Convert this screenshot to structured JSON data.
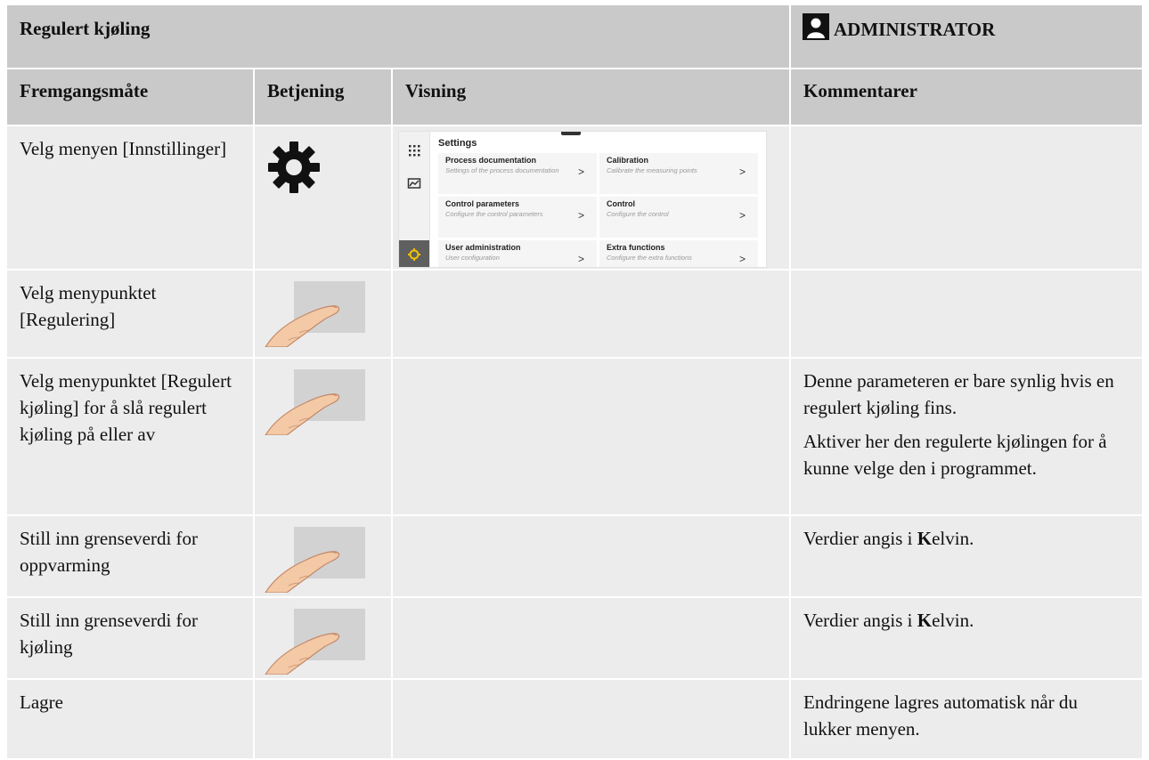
{
  "header": {
    "title": "Regulert kjøling",
    "role": "ADMINISTRATOR",
    "role_icon": "person-icon"
  },
  "columns": [
    "Fremgangsmåte",
    "Betjening",
    "Visning",
    "Kommentarer"
  ],
  "rows": [
    {
      "step": "Velg menyen [Innstillinger]",
      "control_icon": "gear-icon",
      "comments": []
    },
    {
      "step": "Velg menypunktet [Regulering]",
      "control_icon": "finger-touch-icon",
      "comments": []
    },
    {
      "step": "Velg menypunktet [Regulert kjøling] for å slå regulert kjøling på eller av",
      "control_icon": "finger-touch-icon",
      "comments": [
        "Denne parameteren er bare synlig hvis en regulert kjøling fins.",
        "Aktiver her den regulerte kjølingen for å kunne velge den i programmet."
      ]
    },
    {
      "step": "Still inn grenseverdi for oppvarming",
      "control_icon": "finger-touch-icon",
      "comment_bold": "K",
      "comment_pre": "Verdier angis i ",
      "comment_post": "elvin."
    },
    {
      "step": "Still inn grenseverdi for kjøling",
      "control_icon": "finger-touch-icon",
      "comment_bold": "K",
      "comment_pre": "Verdier angis i ",
      "comment_post": "elvin."
    },
    {
      "step": "Lagre",
      "control_icon": "",
      "comments": [
        "Endringene lagres automatisk når du lukker menyen."
      ]
    }
  ],
  "settings_screen": {
    "title": "Settings",
    "cards": [
      {
        "title": "Process documentation",
        "subtitle": "Settings of the process documentation"
      },
      {
        "title": "Calibration",
        "subtitle": "Calibrate the measuring points"
      },
      {
        "title": "Control parameters",
        "subtitle": "Configure the control parameters"
      },
      {
        "title": "Control",
        "subtitle": "Configure the control"
      },
      {
        "title": "User administration",
        "subtitle": "User configuration"
      },
      {
        "title": "Extra functions",
        "subtitle": "Configure the extra functions"
      }
    ],
    "chevron": ">",
    "rail_icons": [
      "apps-grid-icon",
      "chart-icon",
      "gear-icon"
    ],
    "active_color": "#5f5f5f"
  },
  "colors": {
    "header_bg": "#c9c9c9",
    "row_bg": "#ececec"
  }
}
